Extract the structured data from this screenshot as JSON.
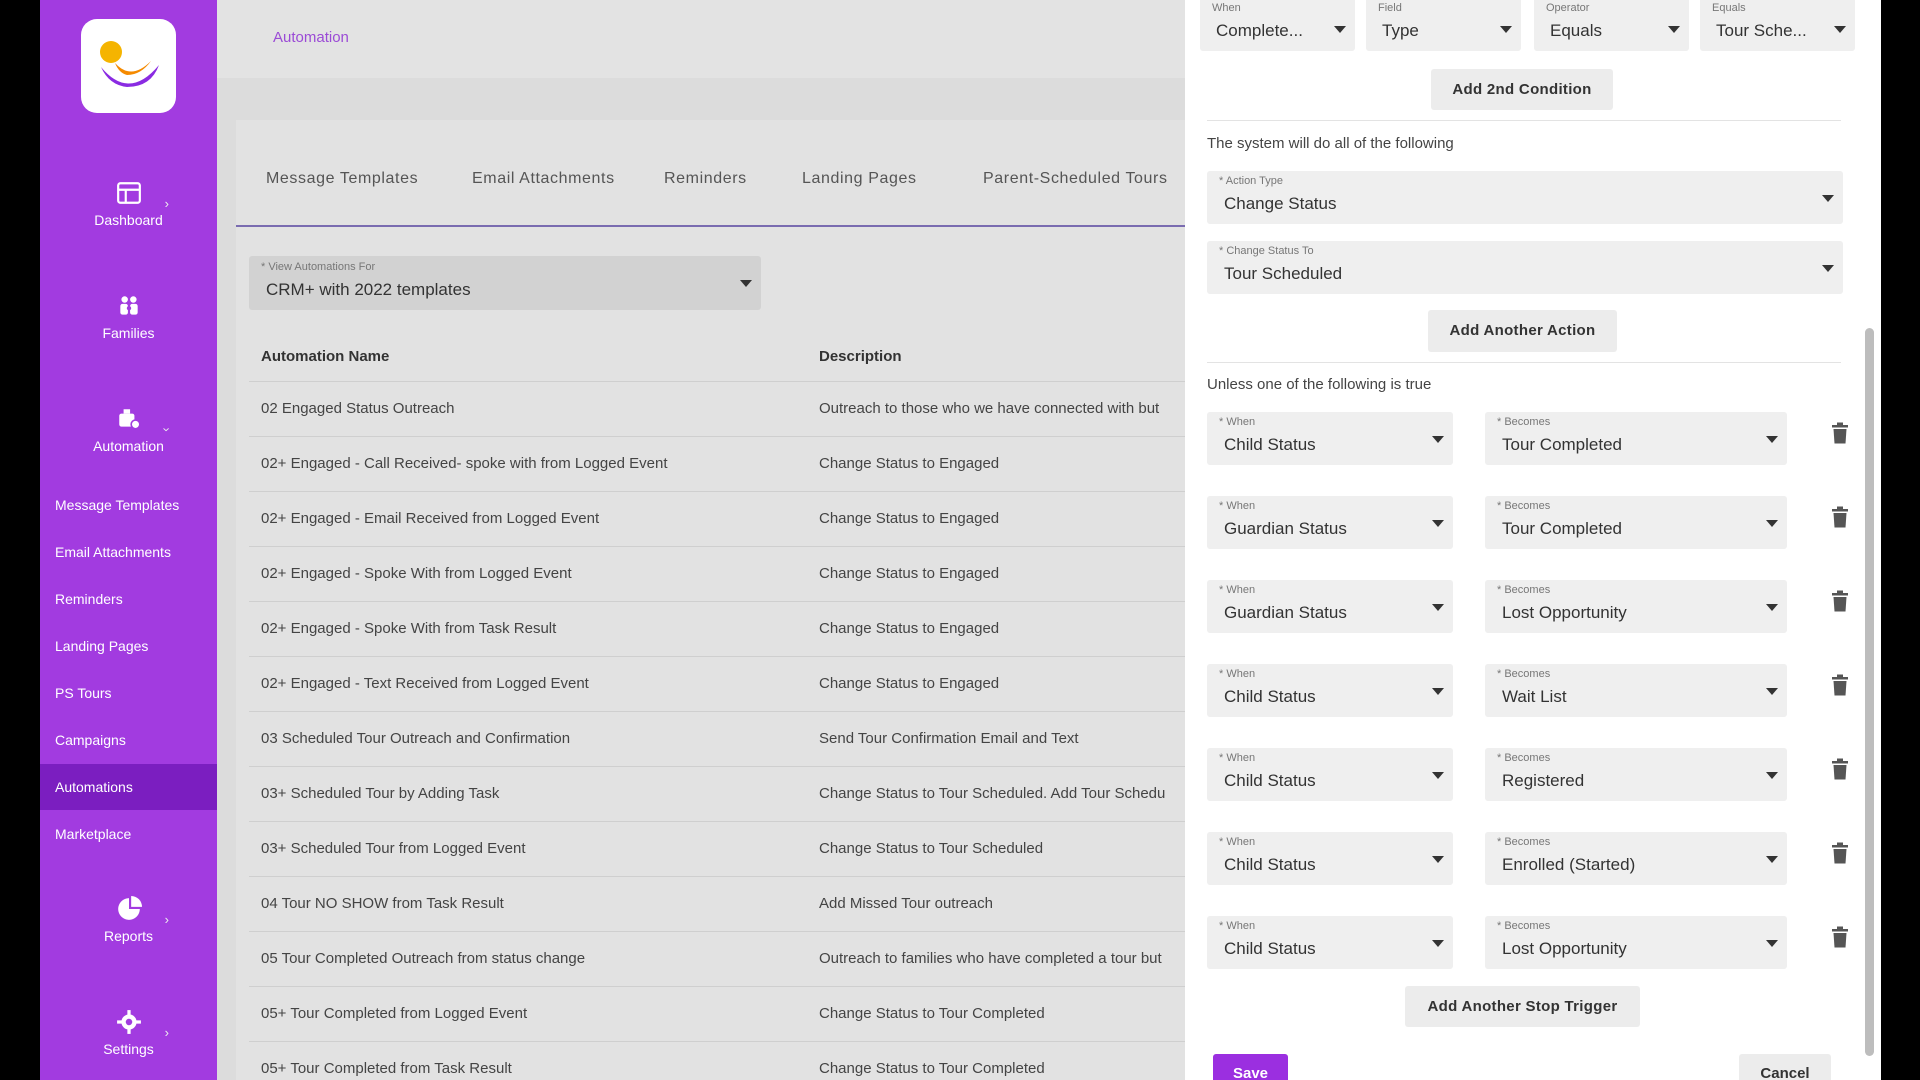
{
  "sidebar": {
    "nav": [
      {
        "label": "Dashboard"
      },
      {
        "label": "Families"
      },
      {
        "label": "Automation"
      },
      {
        "label": "Reports"
      },
      {
        "label": "Settings"
      }
    ],
    "sub_items": [
      {
        "label": "Message Templates"
      },
      {
        "label": "Email Attachments"
      },
      {
        "label": "Reminders"
      },
      {
        "label": "Landing Pages"
      },
      {
        "label": "PS Tours"
      },
      {
        "label": "Campaigns"
      },
      {
        "label": "Automations"
      },
      {
        "label": "Marketplace"
      }
    ],
    "active_sub": "Automations"
  },
  "breadcrumb": "Automation",
  "tabs": [
    {
      "label": "Message Templates"
    },
    {
      "label": "Email Attachments"
    },
    {
      "label": "Reminders"
    },
    {
      "label": "Landing Pages"
    },
    {
      "label": "Parent-Scheduled Tours"
    }
  ],
  "filter": {
    "label": "* View Automations For",
    "value": "CRM+ with 2022 templates"
  },
  "table": {
    "columns": [
      "Automation Name",
      "Description"
    ],
    "rows": [
      {
        "name": "02 Engaged Status Outreach",
        "desc": "Outreach to those who we have connected with but"
      },
      {
        "name": "02+ Engaged - Call Received- spoke with from Logged Event",
        "desc": "Change Status to Engaged"
      },
      {
        "name": "02+ Engaged - Email Received from Logged Event",
        "desc": "Change Status to Engaged"
      },
      {
        "name": "02+ Engaged - Spoke With from Logged Event",
        "desc": "Change Status to Engaged"
      },
      {
        "name": "02+ Engaged - Spoke With from Task Result",
        "desc": "Change Status to Engaged"
      },
      {
        "name": "02+ Engaged - Text Received from Logged Event",
        "desc": "Change Status to Engaged"
      },
      {
        "name": "03 Scheduled Tour Outreach and Confirmation",
        "desc": "Send Tour Confirmation Email and Text"
      },
      {
        "name": "03+ Scheduled Tour by Adding Task",
        "desc": "Change Status to Tour Scheduled. Add Tour Schedu"
      },
      {
        "name": "03+ Scheduled Tour from Logged Event",
        "desc": "Change Status to Tour Scheduled"
      },
      {
        "name": "04 Tour NO SHOW from Task Result",
        "desc": "Add Missed Tour outreach"
      },
      {
        "name": "05 Tour Completed Outreach from status change",
        "desc": "Outreach to families who have completed a tour but"
      },
      {
        "name": "05+ Tour Completed from Logged Event",
        "desc": "Change Status to Tour Completed"
      },
      {
        "name": "05+ Tour Completed from Task Result",
        "desc": "Change Status to Tour Completed"
      }
    ]
  },
  "panel": {
    "condition": [
      {
        "label": "When",
        "value": "Complete..."
      },
      {
        "label": "Field",
        "value": "Type"
      },
      {
        "label": "Operator",
        "value": "Equals"
      },
      {
        "label": "Equals",
        "value": "Tour Sche..."
      }
    ],
    "add_condition": "Add 2nd Condition",
    "actions_heading": "The system will do all of the following",
    "action_type": {
      "label": "* Action Type",
      "value": "Change Status"
    },
    "change_status": {
      "label": "* Change Status To",
      "value": "Tour Scheduled"
    },
    "add_action": "Add Another Action",
    "unless_heading": "Unless one of the following is true",
    "when_label": "* When",
    "becomes_label": "* Becomes",
    "triggers": [
      {
        "when": "Child Status",
        "becomes": "Tour Completed"
      },
      {
        "when": "Guardian Status",
        "becomes": "Tour Completed"
      },
      {
        "when": "Guardian Status",
        "becomes": "Lost Opportunity"
      },
      {
        "when": "Child Status",
        "becomes": "Wait List"
      },
      {
        "when": "Child Status",
        "becomes": "Registered"
      },
      {
        "when": "Child Status",
        "becomes": "Enrolled (Started)"
      },
      {
        "when": "Child Status",
        "becomes": "Lost Opportunity"
      }
    ],
    "add_trigger": "Add Another Stop Trigger",
    "save": "Save",
    "cancel": "Cancel"
  },
  "colors": {
    "sidebar": "#a23be0",
    "sidebar_active": "#7b1ec0",
    "accent": "#9b2fe0"
  }
}
